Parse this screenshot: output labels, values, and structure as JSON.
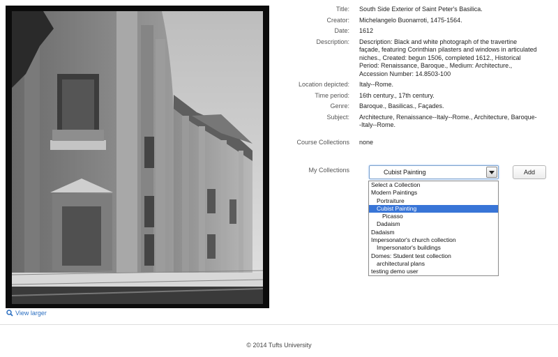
{
  "image": {
    "alt": "South Side Exterior of Saint Peter's Basilica photograph",
    "view_larger_label": "View larger"
  },
  "fields": [
    {
      "label": "Title:",
      "value": "South Side Exterior of Saint Peter's Basilica."
    },
    {
      "label": "Creator:",
      "value": "Michelangelo Buonarroti, 1475-1564."
    },
    {
      "label": "Date:",
      "value": "1612"
    },
    {
      "label": "Description:",
      "value": "Description: Black and white photograph of the travertine façade, featuring Corinthian pilasters and windows in articulated niches., Created: begun 1506, completed 1612., Historical Period: Renaissance, Baroque., Medium: Architecture., Accession Number: 14.8503-100"
    },
    {
      "label": "Location depicted:",
      "value": "Italy--Rome."
    },
    {
      "label": "Time period:",
      "value": "16th century., 17th century."
    },
    {
      "label": "Genre:",
      "value": "Baroque., Basilicas., Façades."
    },
    {
      "label": "Subject:",
      "value": "Architecture, Renaissance--Italy--Rome., Architecture, Baroque--Italy--Rome."
    },
    {
      "label": "Course Collections",
      "value": "none"
    }
  ],
  "my_collections": {
    "label": "My Collections",
    "selected": "Cubist Painting",
    "add_label": "Add",
    "options": [
      {
        "label": "Select a Collection",
        "level": 0,
        "selected": false
      },
      {
        "label": "Modern Paintings",
        "level": 0,
        "selected": false
      },
      {
        "label": "Portraiture",
        "level": 1,
        "selected": false
      },
      {
        "label": "Cubist Painting",
        "level": 1,
        "selected": true
      },
      {
        "label": "Picasso",
        "level": 2,
        "selected": false
      },
      {
        "label": "Dadaism",
        "level": 1,
        "selected": false
      },
      {
        "label": "Dadaism",
        "level": 0,
        "selected": false
      },
      {
        "label": "Impersonator's church collection",
        "level": 0,
        "selected": false
      },
      {
        "label": "Impersonator's buildings",
        "level": 1,
        "selected": false
      },
      {
        "label": "Domes: Student test collection",
        "level": 0,
        "selected": false
      },
      {
        "label": "architectural plans",
        "level": 1,
        "selected": false
      },
      {
        "label": "testing demo user",
        "level": 0,
        "selected": false
      }
    ]
  },
  "footer": {
    "text": "© 2014 Tufts University"
  },
  "colors": {
    "link": "#2a6ec0",
    "selection": "#3875d7",
    "frame": "#0c0c0c"
  }
}
